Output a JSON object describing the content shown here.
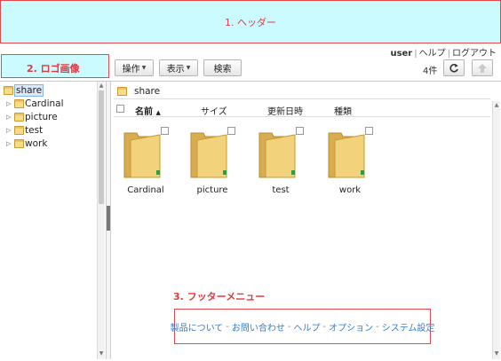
{
  "header": {
    "label": "1. ヘッダー",
    "bg_color": "#ccfbff",
    "border_color": "#e8474f"
  },
  "logo": {
    "label": "2. ロゴ画像"
  },
  "user_bar": {
    "user": "user",
    "help": "ヘルプ",
    "logout": "ログアウト"
  },
  "toolbar": {
    "operations": "操作",
    "view": "表示",
    "search": "検索",
    "count": "4件",
    "refresh_icon": "refresh-icon",
    "up_icon": "up-arrow-icon"
  },
  "tree": {
    "root": "share",
    "items": [
      {
        "label": "Cardinal"
      },
      {
        "label": "picture"
      },
      {
        "label": "test"
      },
      {
        "label": "work"
      }
    ]
  },
  "path": {
    "current": "share"
  },
  "columns": {
    "name": "名前",
    "size": "サイズ",
    "modified": "更新日時",
    "type": "種類"
  },
  "files": [
    {
      "name": "Cardinal"
    },
    {
      "name": "picture"
    },
    {
      "name": "test"
    },
    {
      "name": "work"
    }
  ],
  "footer": {
    "label": "3. フッターメニュー",
    "links": [
      "製品について",
      "お問い合わせ",
      "ヘルプ",
      "オプション",
      "システム設定"
    ],
    "link_color": "#3a7cc2"
  }
}
